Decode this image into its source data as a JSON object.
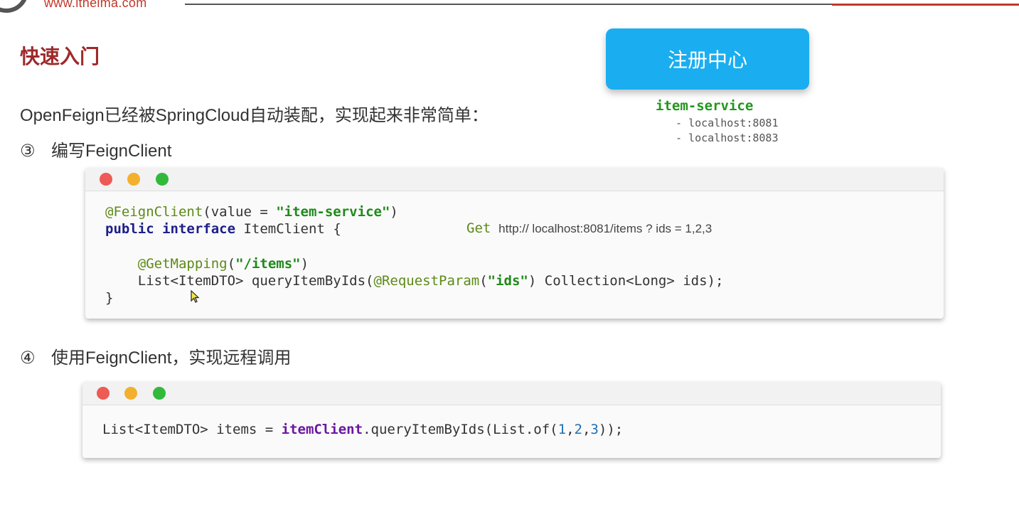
{
  "header": {
    "logo_url": "www.itheima.com"
  },
  "slide": {
    "title": "快速入门",
    "intro": "OpenFeign已经被SpringCloud自动装配，实现起来非常简单：",
    "step3": {
      "num": "③",
      "label": "编写FeignClient"
    },
    "step4": {
      "num": "④",
      "label": "使用FeignClient，实现远程调用"
    }
  },
  "registry": {
    "label": "注册中心",
    "service_name": "item-service",
    "instances": [
      "- localhost:8081",
      "- localhost:8083"
    ]
  },
  "code1": {
    "line1_anno": "@FeignClient",
    "line1_a": "(value = ",
    "line1_str": "\"item-service\"",
    "line1_b": ")",
    "line2_kw1": "public",
    "line2_kw2": "interface",
    "line2_rest": " ItemClient {",
    "line4_anno": "@GetMapping",
    "line4_a": "(",
    "line4_str": "\"/items\"",
    "line4_b": ")",
    "line5_a": "List<ItemDTO> queryItemByIds(",
    "line5_anno": "@RequestParam",
    "line5_b": "(",
    "line5_str": "\"ids\"",
    "line5_c": ") Collection<Long> ids);",
    "line6": "}",
    "note_get": "Get",
    "note_url": "http:// localhost:8081/items ? ids = 1,2,3"
  },
  "code2": {
    "a": "List<ItemDTO> items = ",
    "field": "itemClient",
    "b": ".queryItemByIds(List.of(",
    "n1": "1",
    "c1": ",",
    "n2": "2",
    "c2": ",",
    "n3": "3",
    "d": "));"
  },
  "colors": {
    "title": "#9e2a2b",
    "registry_bg": "#1aaef0",
    "service_name": "#22961c",
    "annotation": "#5c8a16",
    "keyword": "#1d1f8a",
    "string": "#1f8a1a"
  }
}
